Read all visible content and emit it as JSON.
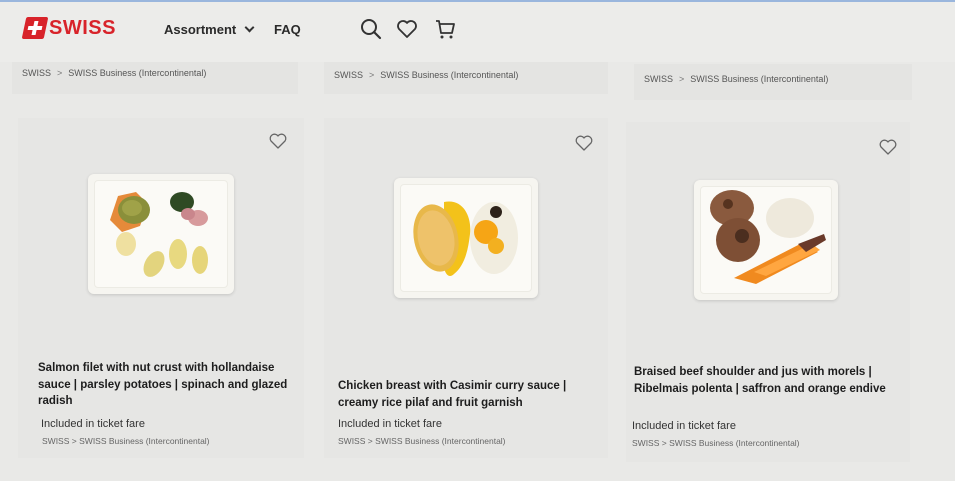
{
  "header": {
    "logo_text": "SWISS",
    "nav": [
      {
        "label": "Assortment"
      },
      {
        "label": "FAQ"
      }
    ],
    "icons": [
      "search-icon",
      "heart-icon",
      "cart-icon"
    ]
  },
  "breadcrumbs": [
    {
      "root": "SWISS",
      "separator": ">",
      "leaf": "SWISS Business (Intercontinental)"
    },
    {
      "root": "SWISS",
      "separator": ">",
      "leaf": "SWISS Business (Intercontinental)"
    },
    {
      "root": "SWISS",
      "separator": ">",
      "leaf": "SWISS Business (Intercontinental)"
    }
  ],
  "products": [
    {
      "title": "Salmon filet with nut crust with hollandaise sauce | parsley potatoes | spinach and glazed radish",
      "fare": "Included in ticket fare",
      "crumb_root": "SWISS",
      "crumb_sep": ">",
      "crumb_leaf": "SWISS Business (Intercontinental)"
    },
    {
      "title": "Chicken breast with Casimir curry sauce | creamy rice pilaf and fruit garnish",
      "fare": "Included in ticket fare",
      "crumb_root": "SWISS",
      "crumb_sep": ">",
      "crumb_leaf": "SWISS Business (Intercontinental)"
    },
    {
      "title": "Braised beef shoulder and jus with morels | Ribelmais polenta | saffron and orange endive",
      "fare": "Included in ticket fare",
      "crumb_root": "SWISS",
      "crumb_sep": ">",
      "crumb_leaf": "SWISS Business (Intercontinental)"
    }
  ],
  "colors": {
    "brand": "#d8232a",
    "background": "#e9e9e7"
  }
}
